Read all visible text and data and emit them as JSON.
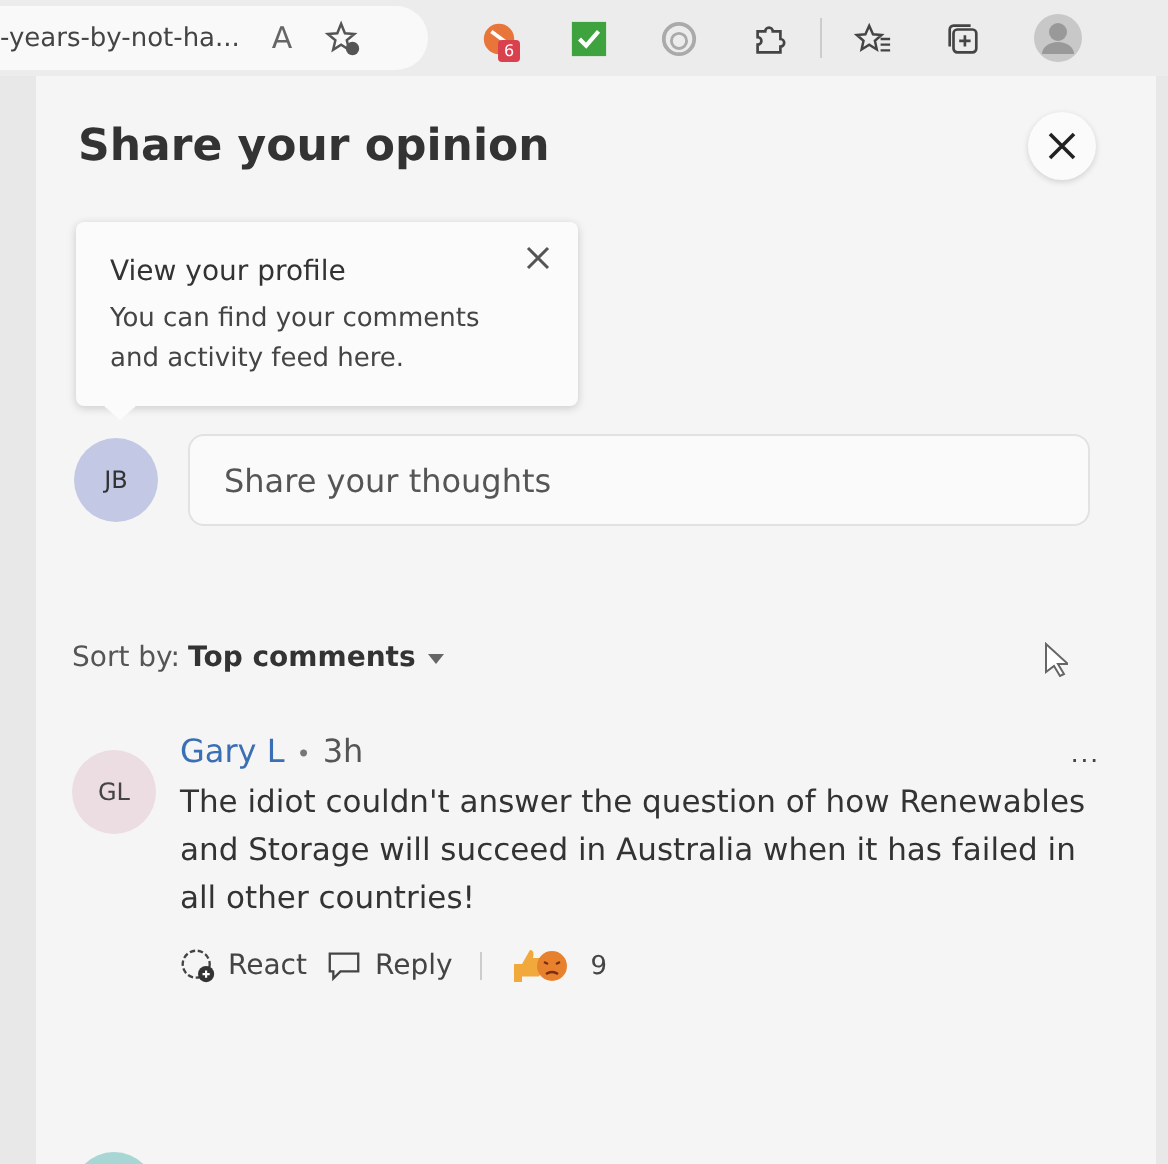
{
  "toolbar": {
    "address": "-years-by-not-ha...",
    "read_aloud_glyph": "A",
    "extension_badge": "6"
  },
  "panel": {
    "title": "Share your opinion",
    "tooltip": {
      "title": "View your profile",
      "text": "You can find your comments and activity feed here."
    },
    "user_initials": "JB",
    "composer": {
      "placeholder": "Share your thoughts"
    },
    "sort": {
      "label": "Sort by:",
      "value": "Top comments"
    },
    "comments": [
      {
        "initials": "GL",
        "author": "Gary L",
        "separator": "•",
        "time": "3h",
        "text": "The idiot couldn't answer the question of how Renewables and Storage will succeed in Australia when it has failed in all other countries!",
        "more": "...",
        "react": "React",
        "reply": "Reply",
        "reaction_count": "9"
      }
    ]
  }
}
